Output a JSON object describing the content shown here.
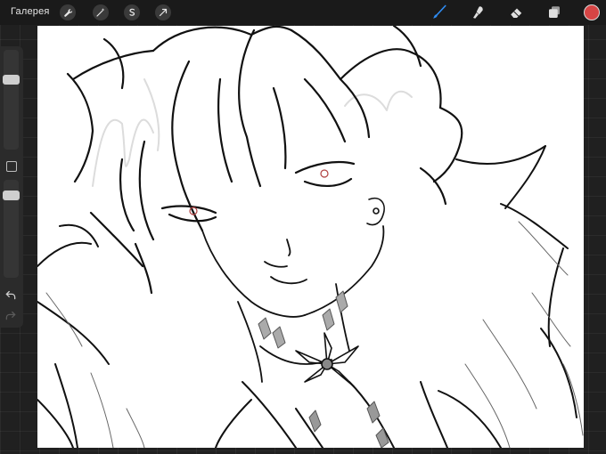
{
  "toolbar": {
    "gallery_label": "Галерея",
    "actions": [
      {
        "name": "actions",
        "icon": "wrench-icon"
      },
      {
        "name": "adjustments",
        "icon": "magic-wand-icon"
      },
      {
        "name": "selection",
        "icon": "selection-s-icon"
      },
      {
        "name": "transform",
        "icon": "arrow-cursor-icon"
      }
    ],
    "tools": [
      {
        "name": "brush",
        "icon": "brush-icon",
        "active": true
      },
      {
        "name": "smudge",
        "icon": "smudge-icon",
        "active": false
      },
      {
        "name": "eraser",
        "icon": "eraser-icon",
        "active": false
      },
      {
        "name": "layers",
        "icon": "layers-icon",
        "active": false
      }
    ],
    "current_color": "#d64545"
  },
  "sidebar": {
    "brush_size_level": 0.28,
    "brush_opacity_level": 0.12,
    "undo_icon": "undo-icon",
    "redo_icon": "redo-icon",
    "modify_icon": "eyedropper-square-icon"
  },
  "colors": {
    "accent_blue": "#2f8cf2",
    "toolbar_bg": "#1a1a1a",
    "workspace_bg": "#202020"
  }
}
